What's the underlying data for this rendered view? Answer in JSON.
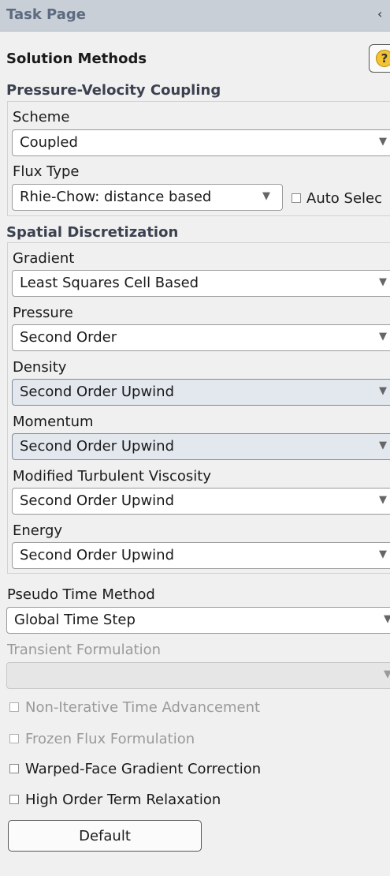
{
  "panel": {
    "title": "Task Page",
    "collapse_glyph": "‹"
  },
  "section_title": "Solution Methods",
  "help_glyph": "?",
  "pv_coupling": {
    "title": "Pressure-Velocity Coupling",
    "scheme_label": "Scheme",
    "scheme_value": "Coupled",
    "flux_label": "Flux Type",
    "flux_value": "Rhie-Chow: distance based",
    "auto_select_label": "Auto Selec"
  },
  "spatial": {
    "title": "Spatial Discretization",
    "rows": [
      {
        "label": "Gradient",
        "value": "Least Squares Cell Based"
      },
      {
        "label": "Pressure",
        "value": "Second Order"
      },
      {
        "label": "Density",
        "value": "Second Order Upwind"
      },
      {
        "label": "Momentum",
        "value": "Second Order Upwind"
      },
      {
        "label": "Modified Turbulent Viscosity",
        "value": "Second Order Upwind"
      },
      {
        "label": "Energy",
        "value": "Second Order Upwind"
      }
    ]
  },
  "pseudo_time": {
    "label": "Pseudo Time Method",
    "value": "Global Time Step"
  },
  "transient": {
    "label": "Transient Formulation",
    "value": ""
  },
  "checkboxes": [
    {
      "label": "Non-Iterative Time Advancement",
      "checked": false,
      "enabled": false
    },
    {
      "label": "Frozen Flux Formulation",
      "checked": false,
      "enabled": false
    },
    {
      "label": "Warped-Face Gradient Correction",
      "checked": false,
      "enabled": true
    },
    {
      "label": "High Order Term Relaxation",
      "checked": false,
      "enabled": true
    }
  ],
  "default_button": "Default",
  "dropdown_arrow": "▼"
}
